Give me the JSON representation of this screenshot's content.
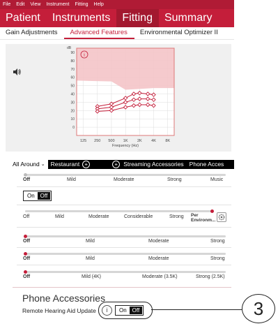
{
  "menu": {
    "items": [
      "File",
      "Edit",
      "View",
      "Instrument",
      "Fitting",
      "Help"
    ]
  },
  "main_tabs": [
    {
      "label": "Patient"
    },
    {
      "label": "Instruments"
    },
    {
      "label": "Fitting"
    },
    {
      "label": "Summary"
    }
  ],
  "active_main_tab": "Fitting",
  "sub_tabs": [
    {
      "label": "Gain Adjustments"
    },
    {
      "label": "Advanced Features"
    },
    {
      "label": "Environmental Optimizer II"
    }
  ],
  "active_sub_tab": "Advanced Features",
  "graph": {
    "y_ticks": [
      "90",
      "80",
      "70",
      "60",
      "50",
      "40",
      "30",
      "20",
      "10",
      "0"
    ],
    "x_ticks": [
      "125",
      "250",
      "500",
      "1K",
      "2K",
      "4K",
      "8K"
    ],
    "xlabel": "Frequency (Hz)",
    "ylabel": "dB",
    "info_glyph": "i",
    "speaker_icon": "speaker-icon",
    "colors": {
      "shade": "#f4c4c8",
      "curve": "#c41e3a"
    }
  },
  "chart_data": {
    "type": "line",
    "x": [
      "250",
      "500",
      "1K",
      "1.5K",
      "2K",
      "3K",
      "4K"
    ],
    "series": [
      {
        "values": [
          25,
          28,
          35,
          40,
          41,
          40,
          39
        ]
      },
      {
        "values": [
          22,
          24,
          30,
          33,
          34,
          34,
          33
        ]
      },
      {
        "values": [
          19,
          20,
          24,
          26,
          27,
          27,
          26
        ]
      }
    ],
    "y_range": [
      -10,
      95
    ],
    "grid": true
  },
  "programs": {
    "items": [
      "All Around",
      "Restaurant"
    ],
    "add_glyph": "+",
    "streaming": "Streaming Accessories",
    "phone": "Phone Acces"
  },
  "sliders": [
    {
      "labels": [
        "Off",
        "Mild",
        "Moderate",
        "Strong",
        "Music"
      ],
      "level": 0.0
    },
    {
      "labels": [
        "Off",
        "Mild",
        "Moderate",
        "Considerable",
        "Strong",
        "Per Environm..."
      ],
      "level": 1.0
    },
    {
      "labels": [
        "Off",
        "Mild",
        "Moderate",
        "Strong"
      ],
      "level": 0.0
    },
    {
      "labels": [
        "Off",
        "Mild",
        "Moderate",
        "Strong"
      ],
      "level": 0.0
    },
    {
      "labels": [
        "Off",
        "Mild (4K)",
        "Moderate (3.5K)",
        "Strong (2.5K)"
      ],
      "level": 0.0
    }
  ],
  "toggle1": {
    "on": "On",
    "off": "Off"
  },
  "phone_accessories": {
    "title": "Phone Accessories",
    "remote_label": "Remote Hearing Aid Update",
    "info_glyph": "i",
    "toggle_on": "On",
    "toggle_off": "Off"
  },
  "callout": {
    "number": "3"
  }
}
